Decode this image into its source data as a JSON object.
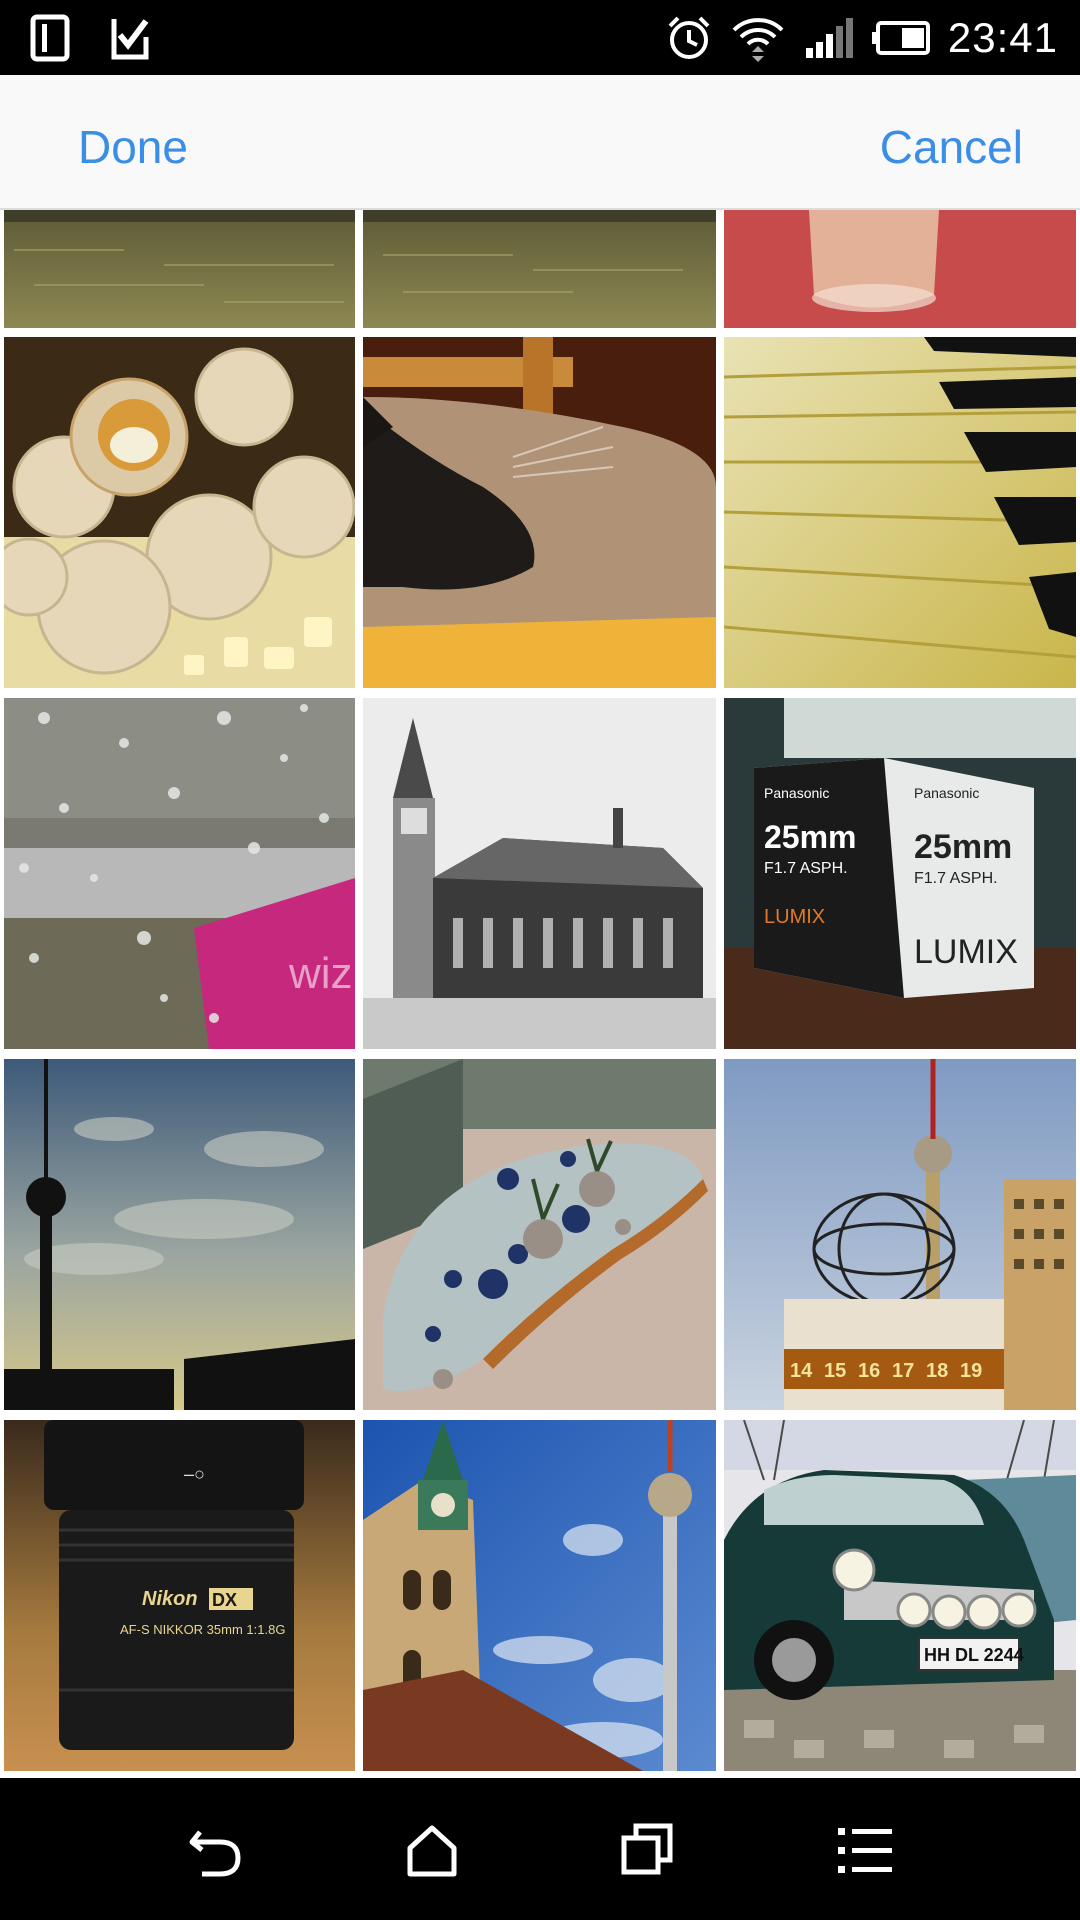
{
  "status_bar": {
    "time": "23:41",
    "icons": [
      "sim-card-icon",
      "clipboard-check-icon",
      "alarm-clock-icon",
      "wifi-icon",
      "cell-signal-icon",
      "battery-icon"
    ]
  },
  "action_bar": {
    "done_label": "Done",
    "cancel_label": "Cancel"
  },
  "photo_grid": {
    "photos": [
      {
        "subject": "river-water"
      },
      {
        "subject": "river-water"
      },
      {
        "subject": "glass-on-red-table"
      },
      {
        "subject": "coconut-pralines"
      },
      {
        "subject": "sleeping-cat"
      },
      {
        "subject": "piano-keys"
      },
      {
        "subject": "raindrops-on-window",
        "text": "wiz"
      },
      {
        "subject": "church-black-and-white"
      },
      {
        "subject": "lens-box",
        "text": [
          "Panasonic",
          "25mm",
          "F1.7 ASPH.",
          "LUMIX"
        ]
      },
      {
        "subject": "tv-tower-silhouette"
      },
      {
        "subject": "courtyard-spheres"
      },
      {
        "subject": "world-clock-and-tv-tower",
        "text": [
          "14",
          "15",
          "16",
          "17",
          "18",
          "19"
        ]
      },
      {
        "subject": "camera-lens",
        "text": [
          "Nikon",
          "DX",
          "AF-S NIKKOR 35mm 1:1.8G"
        ]
      },
      {
        "subject": "church-tower-and-tv-tower"
      },
      {
        "subject": "mini-cooper",
        "text": "HH DL 2244"
      }
    ]
  },
  "nav_bar": {
    "icons": [
      "back-icon",
      "home-icon",
      "recents-icon",
      "menu-icon"
    ]
  },
  "colors": {
    "accent": "#3a8ee6",
    "status_bar": "#000000",
    "action_bar": "#f9f9f9"
  }
}
